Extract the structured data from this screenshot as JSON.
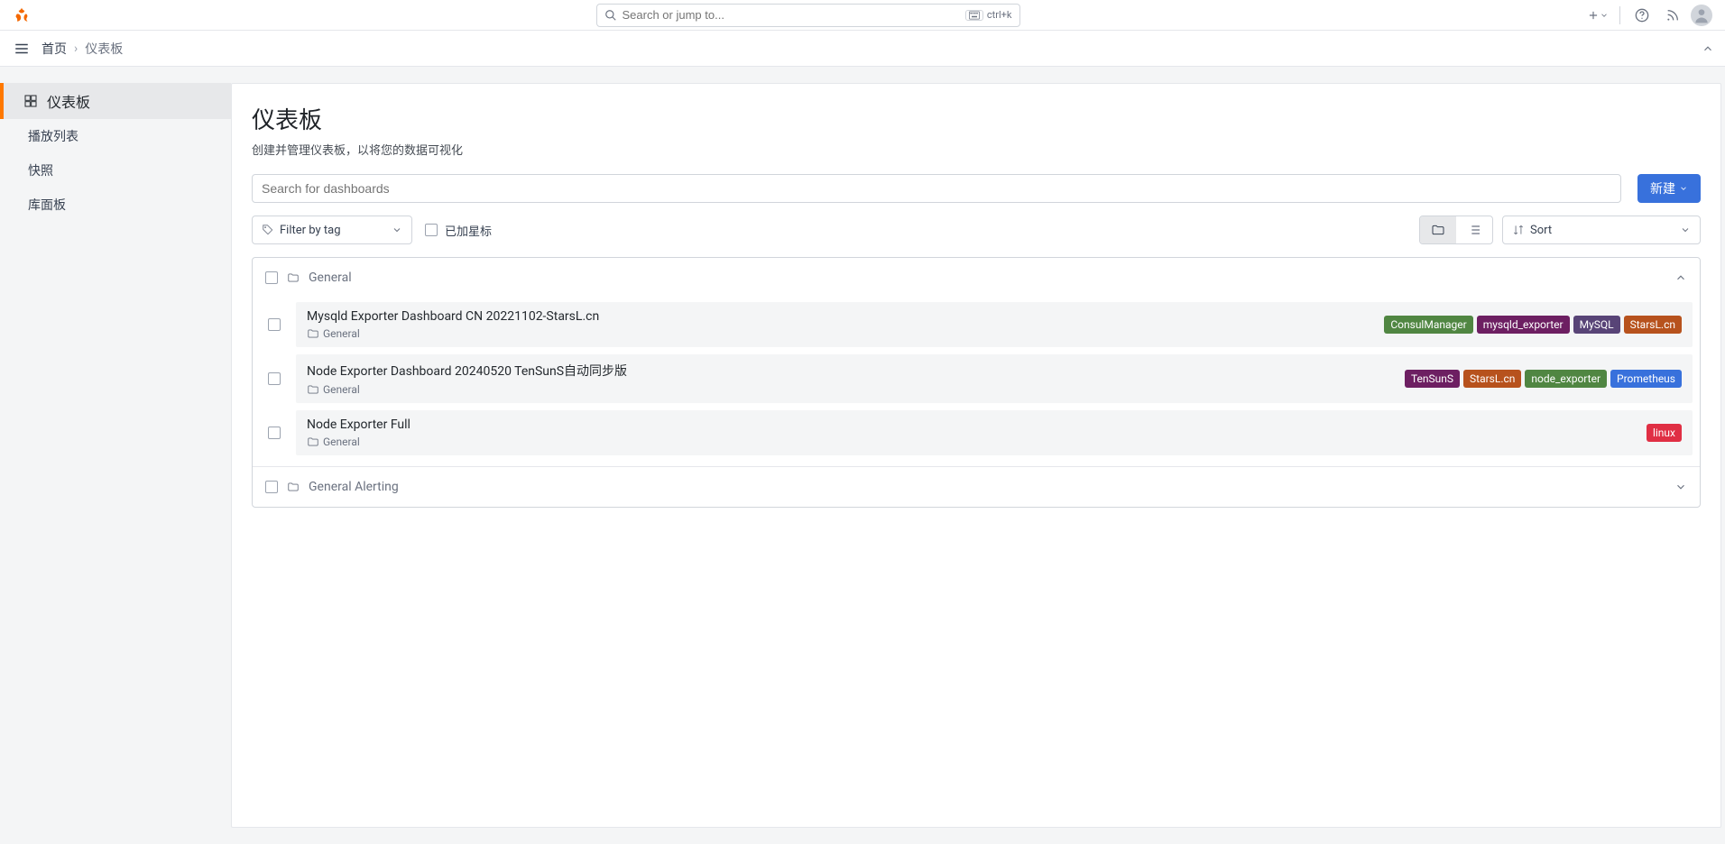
{
  "topbar": {
    "search_placeholder": "Search or jump to...",
    "shortcut": "ctrl+k"
  },
  "breadcrumb": {
    "home": "首页",
    "current": "仪表板"
  },
  "sidebar": {
    "items": [
      {
        "label": "仪表板",
        "active": true,
        "icon": true
      },
      {
        "label": "播放列表",
        "active": false
      },
      {
        "label": "快照",
        "active": false
      },
      {
        "label": "库面板",
        "active": false
      }
    ]
  },
  "page": {
    "title": "仪表板",
    "subtitle": "创建并管理仪表板，以将您的数据可视化",
    "search_placeholder": "Search for dashboards",
    "new_button": "新建",
    "filter_by_tag": "Filter by tag",
    "starred": "已加星标",
    "sort": "Sort"
  },
  "folders": [
    {
      "name": "General",
      "expanded": true,
      "dashboards": [
        {
          "title": "Mysqld Exporter Dashboard CN 20221102-StarsL.cn",
          "folder": "General",
          "tags": [
            {
              "text": "ConsulManager",
              "color": "#508642"
            },
            {
              "text": "mysqld_exporter",
              "color": "#6d1f62"
            },
            {
              "text": "MySQL",
              "color": "#584477"
            },
            {
              "text": "StarsL.cn",
              "color": "#b7521d"
            }
          ]
        },
        {
          "title": "Node Exporter Dashboard 20240520 TenSunS自动同步版",
          "folder": "General",
          "tags": [
            {
              "text": "TenSunS",
              "color": "#6d1f62"
            },
            {
              "text": "StarsL.cn",
              "color": "#b7521d"
            },
            {
              "text": "node_exporter",
              "color": "#508642"
            },
            {
              "text": "Prometheus",
              "color": "#3871dc"
            }
          ]
        },
        {
          "title": "Node Exporter Full",
          "folder": "General",
          "tags": [
            {
              "text": "linux",
              "color": "#e02f44"
            }
          ]
        }
      ]
    },
    {
      "name": "General Alerting",
      "expanded": false,
      "dashboards": []
    }
  ]
}
